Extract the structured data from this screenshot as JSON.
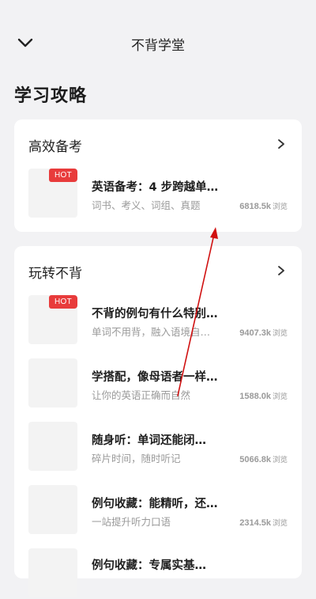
{
  "header": {
    "title": "不背学堂",
    "back_icon": "chevron-down-icon"
  },
  "section": {
    "title": "学习攻略"
  },
  "cards": [
    {
      "title": "高效备考",
      "more_icon": "chevron-right-icon",
      "items": [
        {
          "hot": "HOT",
          "title": "英语备考：4 步跨越单…",
          "subtitle": "词书、考义、词组、真题",
          "views": "6818.5k",
          "views_unit": "浏览"
        }
      ]
    },
    {
      "title": "玩转不背",
      "more_icon": "chevron-right-icon",
      "items": [
        {
          "hot": "HOT",
          "title": "不背的例句有什么特别…",
          "subtitle": "单词不用背，融入语境自…",
          "views": "9407.3k",
          "views_unit": "浏览"
        },
        {
          "title": "学搭配，像母语者一样…",
          "subtitle": "让你的英语正确而自然",
          "views": "1588.0k",
          "views_unit": "浏览"
        },
        {
          "title": "随身听：单词还能闭…",
          "subtitle": "碎片时间，随时听记",
          "views": "5066.8k",
          "views_unit": "浏览"
        },
        {
          "title": "例句收藏：能精听，还…",
          "subtitle": "一站提升听力口语",
          "views": "2314.5k",
          "views_unit": "浏览"
        },
        {
          "title": "例句收藏：专属实基…"
        }
      ]
    }
  ],
  "colors": {
    "background": "#f2f2f4",
    "card": "#ffffff",
    "hot_badge": "#e83b3b",
    "annotation_arrow": "#d01010"
  }
}
